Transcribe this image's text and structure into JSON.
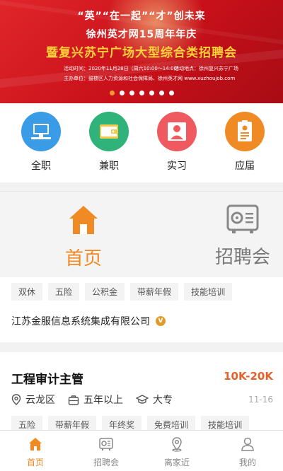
{
  "banner": {
    "slogan": "“英”“在一起”“才”创未来",
    "subtitle": "徐州英才网15周年年庆",
    "headline": "暨复兴苏宁广场大型综合类招聘会",
    "time_info": "活动时间：2020年11月28日（周六10:00～14:00）",
    "place_info": "活动地点：徐州复兴苏宁广场",
    "host_info": "主办单位：鼓楼区人力资源和社会保障局、徐州英才网 www.xuzhoujob.com",
    "slide_count": 7,
    "active_slide": 1
  },
  "categories": [
    {
      "label": "全职",
      "icon": "computer-icon",
      "color": "#3a9be6"
    },
    {
      "label": "兼职",
      "icon": "wallet-icon",
      "color": "#2fb37a"
    },
    {
      "label": "实习",
      "icon": "person-icon",
      "color": "#ee5a5f"
    },
    {
      "label": "应届",
      "icon": "id-card-icon",
      "color": "#f08a24"
    }
  ],
  "tabs": [
    {
      "label": "首页",
      "icon": "home-icon",
      "active": true
    },
    {
      "label": "招聘会",
      "icon": "safe-icon",
      "active": false
    }
  ],
  "prev_job": {
    "tags": [
      "双休",
      "五险",
      "公积金",
      "带薪年假",
      "技能培训"
    ],
    "company": "江苏金服信息系统集成有限公司",
    "verified_badge": "V"
  },
  "job": {
    "title": "工程审计主管",
    "salary": "10K-20K",
    "location": "云龙区",
    "experience": "五年以上",
    "education": "大专",
    "date": "11-16",
    "tags": [
      "五险",
      "带薪年假",
      "年终奖",
      "免费培训",
      "技能培训"
    ]
  },
  "nav": [
    {
      "label": "首页",
      "icon": "home-icon",
      "active": true
    },
    {
      "label": "招聘会",
      "icon": "safe-icon",
      "active": false
    },
    {
      "label": "离家近",
      "icon": "location-pin-icon",
      "active": false
    },
    {
      "label": "我的",
      "icon": "user-icon",
      "active": false
    }
  ],
  "colors": {
    "accent": "#f08a24",
    "salary": "#e2622a",
    "banner_red": "#c8101a"
  }
}
